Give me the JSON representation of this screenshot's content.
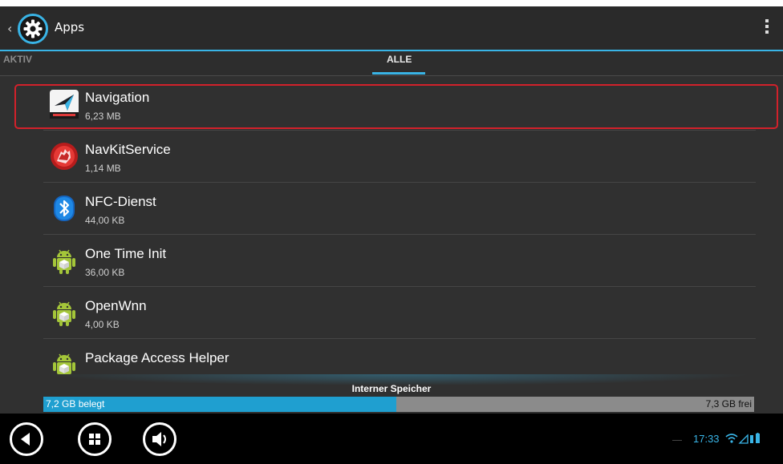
{
  "actionbar": {
    "title": "Apps",
    "icon": "settings-gear-icon",
    "up_icon": "chevron-left-icon",
    "overflow_icon": "overflow-menu-icon"
  },
  "tabs": [
    {
      "label": "AKTIV",
      "selected": false
    },
    {
      "label": "ALLE",
      "selected": true
    }
  ],
  "apps": [
    {
      "name": "Navigation",
      "size": "6,23 MB",
      "icon": "tomtom-navigation-icon",
      "highlighted": true
    },
    {
      "name": "NavKitService",
      "size": "1,14 MB",
      "icon": "navkit-hand-icon"
    },
    {
      "name": "NFC-Dienst",
      "size": "44,00 KB",
      "icon": "bluetooth-icon"
    },
    {
      "name": "One Time Init",
      "size": "36,00 KB",
      "icon": "android-icon"
    },
    {
      "name": "OpenWnn",
      "size": "4,00 KB",
      "icon": "android-icon"
    },
    {
      "name": "Package Access Helper",
      "size": "",
      "icon": "android-icon"
    }
  ],
  "storage": {
    "label": "Interner Speicher",
    "used": "7,2 GB belegt",
    "free": "7,3 GB frei",
    "used_fraction": 0.497,
    "used_color": "#1f9fd0"
  },
  "navbar": {
    "buttons": [
      "back-icon",
      "home-grid-icon",
      "volume-icon"
    ],
    "time": "17:33",
    "status_icons": "wifi-icon signal-icon battery-icon"
  },
  "colors": {
    "accent": "#39b4e6",
    "highlight": "#d2212b",
    "background": "#303030"
  }
}
